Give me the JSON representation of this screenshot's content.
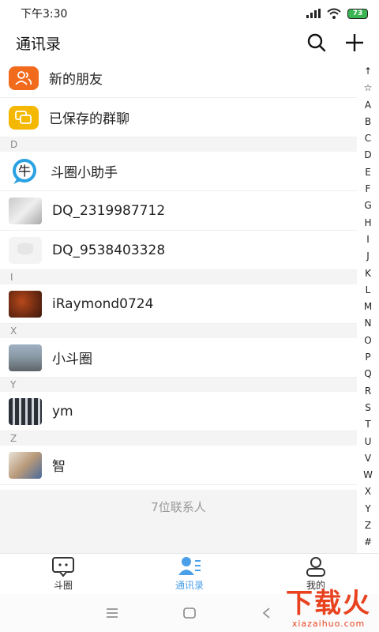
{
  "status": {
    "time": "下午3:30",
    "battery": "73"
  },
  "header": {
    "title": "通讯录"
  },
  "top_items": [
    {
      "label": "新的朋友",
      "icon": "new-friends-icon",
      "color": "#f26a1b"
    },
    {
      "label": "已保存的群聊",
      "icon": "group-chat-icon",
      "color": "#f5b800"
    }
  ],
  "sections": [
    {
      "letter": "D",
      "contacts": [
        "斗圈小助手",
        "DQ_2319987712",
        "DQ_9538403328"
      ]
    },
    {
      "letter": "I",
      "contacts": [
        "iRaymond0724"
      ]
    },
    {
      "letter": "X",
      "contacts": [
        "小斗圈"
      ]
    },
    {
      "letter": "Y",
      "contacts": [
        "ym"
      ]
    },
    {
      "letter": "Z",
      "contacts": [
        "智"
      ]
    }
  ],
  "contact_count": "7位联系人",
  "index": [
    "↑",
    "☆",
    "A",
    "B",
    "C",
    "D",
    "E",
    "F",
    "G",
    "H",
    "I",
    "J",
    "K",
    "L",
    "M",
    "N",
    "O",
    "P",
    "Q",
    "R",
    "S",
    "T",
    "U",
    "V",
    "W",
    "X",
    "Y",
    "Z",
    "#"
  ],
  "tabs": [
    {
      "label": "斗圈",
      "icon": "chat-bubble-icon",
      "active": false
    },
    {
      "label": "通讯录",
      "icon": "contacts-icon",
      "active": true
    },
    {
      "label": "我的",
      "icon": "profile-icon",
      "active": false
    }
  ],
  "watermark": {
    "main": "下载火",
    "sub": "xiazaihuo.com"
  },
  "colors": {
    "accent": "#4a9fe8",
    "section_bg": "#f4f4f4"
  }
}
